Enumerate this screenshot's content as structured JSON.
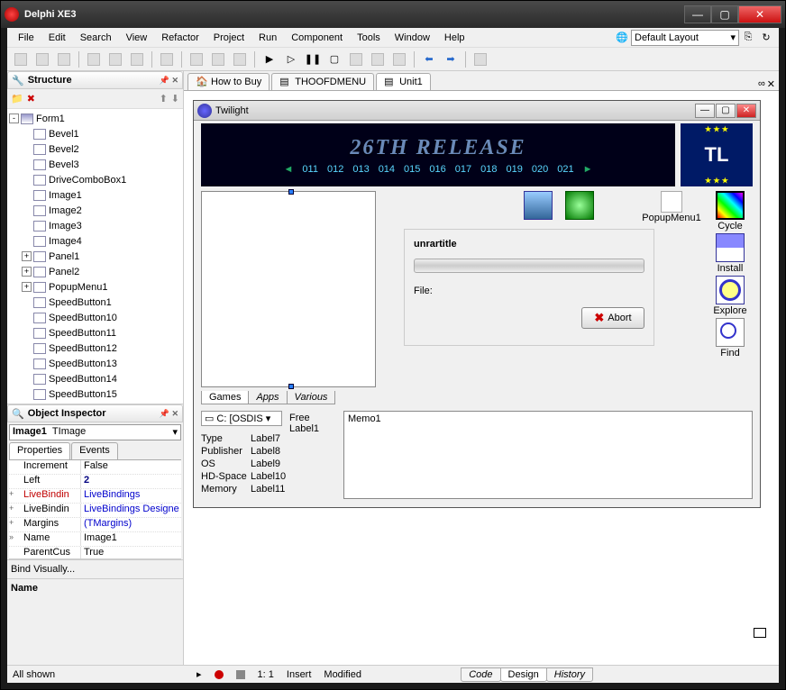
{
  "window": {
    "title": "Delphi XE3"
  },
  "menubar": {
    "items": [
      "File",
      "Edit",
      "Search",
      "View",
      "Refactor",
      "Project",
      "Run",
      "Component",
      "Tools",
      "Window",
      "Help"
    ],
    "layout_label": "Default Layout"
  },
  "structure": {
    "title": "Structure",
    "root": "Form1",
    "items": [
      "Bevel1",
      "Bevel2",
      "Bevel3",
      "DriveComboBox1",
      "Image1",
      "Image2",
      "Image3",
      "Image4",
      "Panel1",
      "Panel2",
      "PopupMenu1",
      "SpeedButton1",
      "SpeedButton10",
      "SpeedButton11",
      "SpeedButton12",
      "SpeedButton13",
      "SpeedButton14",
      "SpeedButton15"
    ]
  },
  "object_inspector": {
    "title": "Object Inspector",
    "component_name": "Image1",
    "component_type": "TImage",
    "tabs": [
      "Properties",
      "Events"
    ],
    "props": [
      {
        "plus": "",
        "k": "Increment",
        "v": "False",
        "cls": ""
      },
      {
        "plus": "",
        "k": "Left",
        "v": "2",
        "cls": "val-navy"
      },
      {
        "plus": "+",
        "k": "LiveBindin",
        "v": "LiveBindings",
        "cls": "link-blue",
        "kcls": "link-red"
      },
      {
        "plus": "+",
        "k": "LiveBindin",
        "v": "LiveBindings Designe",
        "cls": "link-blue"
      },
      {
        "plus": "+",
        "k": "Margins",
        "v": "(TMargins)",
        "cls": "link-blue"
      },
      {
        "plus": "»",
        "k": "Name",
        "v": "Image1",
        "cls": ""
      },
      {
        "plus": "",
        "k": "ParentCus",
        "v": "True",
        "cls": ""
      }
    ],
    "bind_visually": "Bind Visually...",
    "name_label": "Name",
    "all_shown": "All shown"
  },
  "doc_tabs": [
    {
      "label": "How to Buy",
      "icon": "home"
    },
    {
      "label": "THOOFDMENU",
      "icon": "form"
    },
    {
      "label": "Unit1",
      "icon": "unit",
      "active": true
    }
  ],
  "form": {
    "caption": "Twilight",
    "banner_title": "26TH RELEASE",
    "banner_nums": [
      "◄",
      "011",
      "012",
      "013",
      "014",
      "015",
      "016",
      "017",
      "018",
      "019",
      "020",
      "021",
      "►"
    ],
    "tl_logo": "TL",
    "popupmenu_label": "PopupMenu1",
    "cycle_buttons": [
      {
        "label": "Cycle",
        "icon": "ic-cycle"
      },
      {
        "label": "Install",
        "icon": "ic-install"
      },
      {
        "label": "Explore",
        "icon": "ic-explore"
      },
      {
        "label": "Find",
        "icon": "ic-find"
      }
    ],
    "unrar": {
      "title": "unrartitle",
      "file_label": "File:",
      "abort": "Abort"
    },
    "gat_tabs": [
      "Games",
      "Apps",
      "Various"
    ],
    "drive_text": "C: [OSDIS",
    "free_label": "Free Label1",
    "info_rows": [
      {
        "k": "Type",
        "v": "Label7"
      },
      {
        "k": "Publisher",
        "v": "Label8"
      },
      {
        "k": "OS",
        "v": "Label9"
      },
      {
        "k": "HD-Space",
        "v": "Label10"
      },
      {
        "k": "Memory",
        "v": "Label11"
      }
    ],
    "memo": "Memo1"
  },
  "status": {
    "pos": "1: 1",
    "insert": "Insert",
    "modified": "Modified",
    "tabs": [
      "Code",
      "Design",
      "History"
    ]
  }
}
